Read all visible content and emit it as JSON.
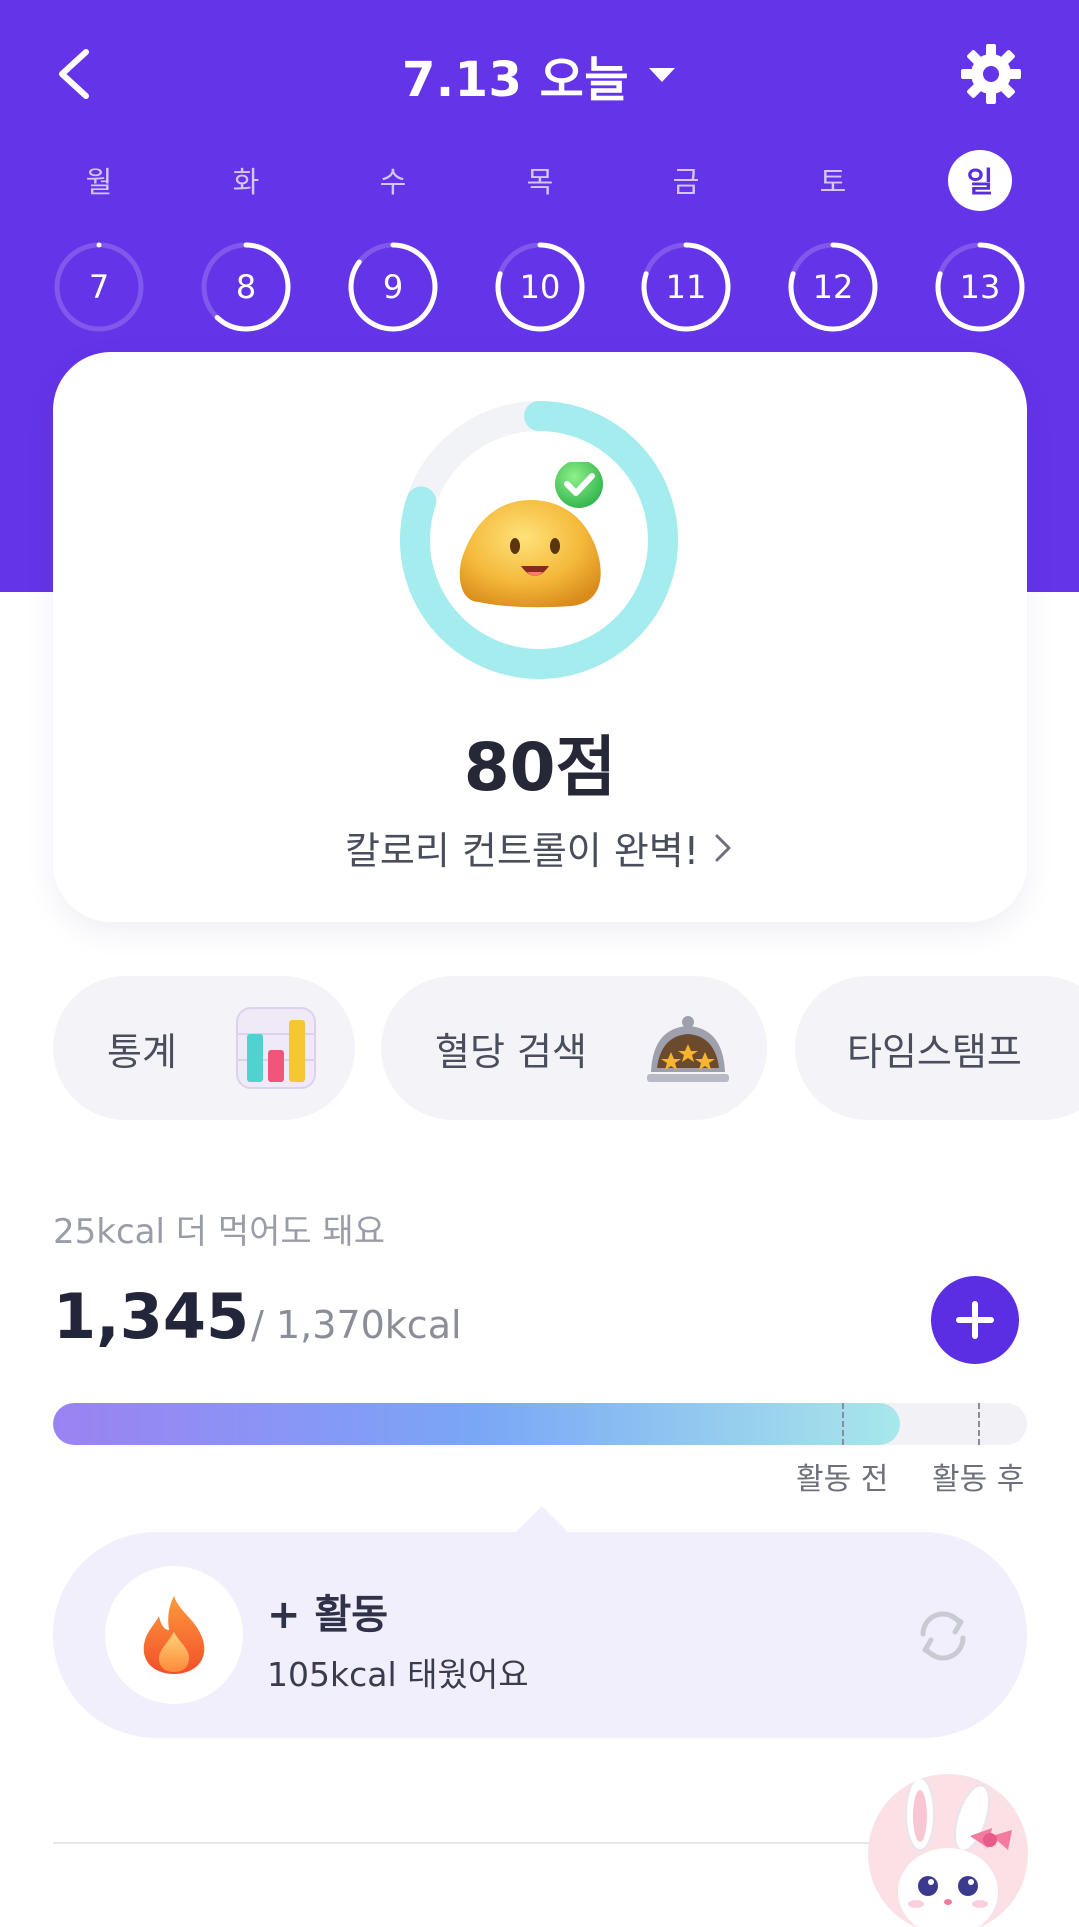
{
  "header": {
    "title": "7.13 오늘",
    "accent": "#6434e8"
  },
  "week": [
    {
      "label": "월",
      "num": "7",
      "progress": 0.0,
      "active": false
    },
    {
      "label": "화",
      "num": "8",
      "progress": 0.62,
      "active": false
    },
    {
      "label": "수",
      "num": "9",
      "progress": 0.85,
      "active": false
    },
    {
      "label": "목",
      "num": "10",
      "progress": 0.8,
      "active": false
    },
    {
      "label": "금",
      "num": "11",
      "progress": 0.8,
      "active": false
    },
    {
      "label": "토",
      "num": "12",
      "progress": 0.8,
      "active": false
    },
    {
      "label": "일",
      "num": "13",
      "progress": 0.8,
      "active": true
    }
  ],
  "score": {
    "value": "80점",
    "message": "칼로리 컨트롤이 완벽!",
    "progress": 0.8
  },
  "chips": [
    {
      "label": "통계",
      "icon": "bar-chart-icon"
    },
    {
      "label": "혈당 검색",
      "icon": "food-cloche-icon"
    },
    {
      "label": "타임스탬프",
      "icon": ""
    }
  ],
  "calories": {
    "hint": "25kcal 더 먹어도 돼요",
    "current": "1,345",
    "total": "/ 1,370kcal",
    "progress": 0.87,
    "marker_before": "활동 전",
    "marker_after": "활동 후"
  },
  "activity": {
    "title": "+ 활동",
    "subtitle": "105kcal 태웠어요",
    "icon": "fire-icon"
  },
  "assistant": {
    "icon": "bunny-avatar-icon"
  }
}
